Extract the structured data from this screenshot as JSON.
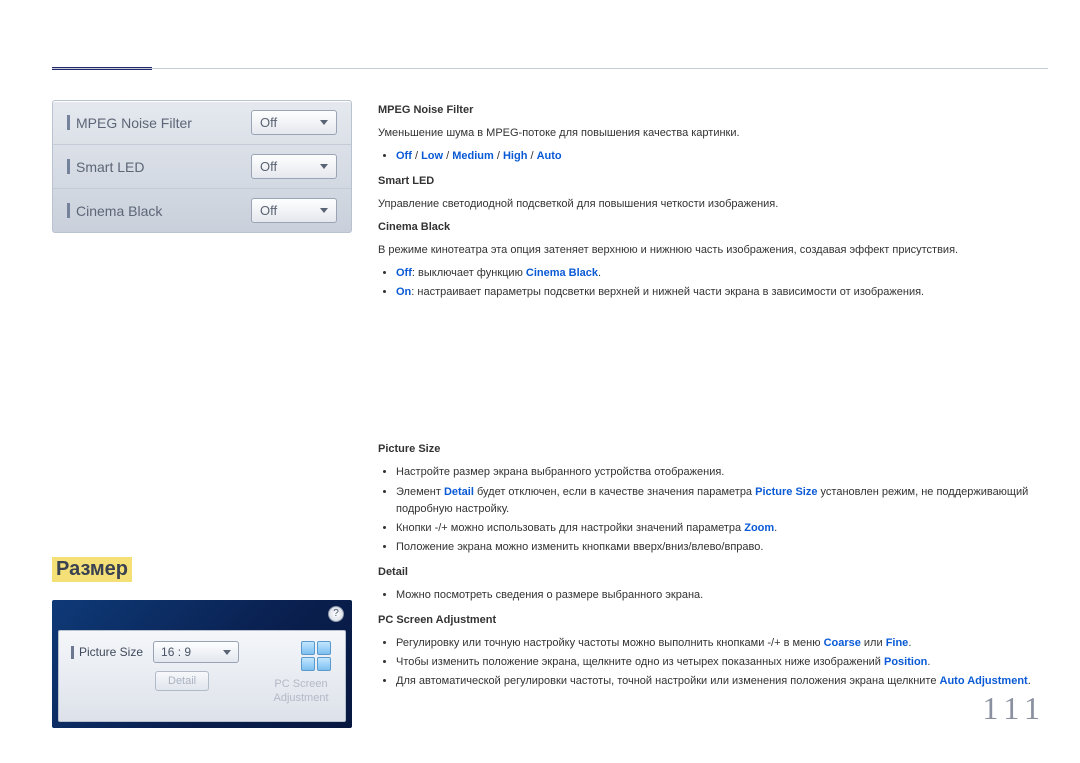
{
  "page_number": "111",
  "osd1": {
    "rows": [
      {
        "label": "MPEG Noise Filter",
        "value": "Off"
      },
      {
        "label": "Smart LED",
        "value": "Off"
      },
      {
        "label": "Cinema Black",
        "value": "Off"
      }
    ]
  },
  "section1": {
    "mpeg_title": "MPEG Noise Filter",
    "mpeg_desc": "Уменьшение шума в MPEG-потоке для повышения качества картинки.",
    "mpeg_opts": {
      "off": "Off",
      "low": "Low",
      "medium": "Medium",
      "high": "High",
      "auto": "Auto",
      "sep": " / "
    },
    "smart_title": "Smart LED",
    "smart_desc": "Управление светодиодной подсветкой для повышения четкости изображения.",
    "cinema_title": "Cinema Black",
    "cinema_desc": "В режиме кинотеатра эта опция затеняет верхнюю и нижнюю часть изображения, создавая эффект присутствия.",
    "cinema_off_kw": "Off",
    "cinema_off_text": ": выключает функцию ",
    "cinema_off_kw2": "Cinema Black",
    "cinema_off_text2": ".",
    "cinema_on_kw": "On",
    "cinema_on_text": ": настраивает параметры подсветки верхней и нижней части экрана в зависимости от изображения."
  },
  "section2_title": "Размер",
  "osd2": {
    "help": "?",
    "picture_size_label": "Picture Size",
    "picture_size_value": "16 : 9",
    "detail_btn": "Detail",
    "pc_screen_line1": "PC Screen",
    "pc_screen_line2": "Adjustment"
  },
  "section2": {
    "ps_title": "Picture Size",
    "ps_b1": "Настройте размер экрана выбранного устройства отображения.",
    "ps_b2_a": "Элемент ",
    "ps_b2_kw1": "Detail",
    "ps_b2_b": " будет отключен, если в качестве значения параметра ",
    "ps_b2_kw2": "Picture Size",
    "ps_b2_c": " установлен режим, не поддерживающий подробную настройку.",
    "ps_b3_a": "Кнопки -/+ можно использовать для настройки значений параметра ",
    "ps_b3_kw": "Zoom",
    "ps_b3_b": ".",
    "ps_b4": "Положение экрана можно изменить кнопками вверх/вниз/влево/вправо.",
    "detail_title": "Detail",
    "detail_b1": "Можно посмотреть сведения о размере выбранного экрана.",
    "pcadj_title": "PC Screen Adjustment",
    "pcadj_b1_a": "Регулировку или точную настройку частоты можно выполнить кнопками -/+ в меню ",
    "pcadj_b1_kw1": "Coarse",
    "pcadj_b1_b": " или ",
    "pcadj_b1_kw2": "Fine",
    "pcadj_b1_c": ".",
    "pcadj_b2_a": "Чтобы изменить положение экрана, щелкните одно из четырех показанных ниже изображений ",
    "pcadj_b2_kw": "Position",
    "pcadj_b2_b": ".",
    "pcadj_b3_a": "Для автоматической регулировки частоты, точной настройки или изменения положения экрана щелкните ",
    "pcadj_b3_kw": "Auto Adjustment",
    "pcadj_b3_b": "."
  }
}
